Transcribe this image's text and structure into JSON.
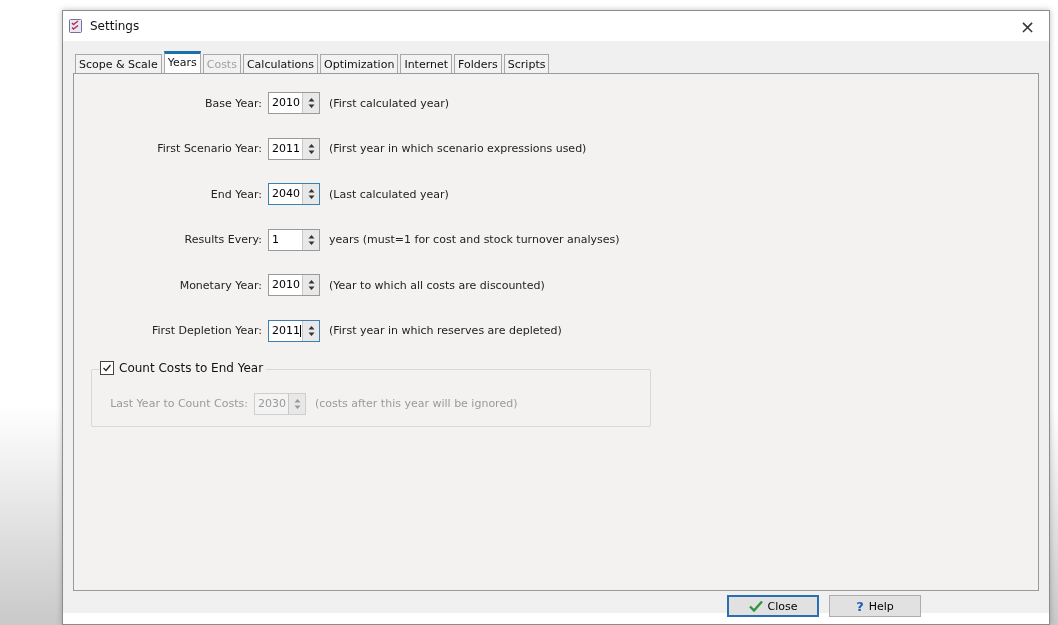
{
  "window": {
    "title": "Settings",
    "close": "×"
  },
  "tabs": [
    {
      "label": "Scope & Scale",
      "selected": false,
      "disabled": false
    },
    {
      "label": "Years",
      "selected": true,
      "disabled": false
    },
    {
      "label": "Costs",
      "selected": false,
      "disabled": true
    },
    {
      "label": "Calculations",
      "selected": false,
      "disabled": false
    },
    {
      "label": "Optimization",
      "selected": false,
      "disabled": false
    },
    {
      "label": "Internet",
      "selected": false,
      "disabled": false
    },
    {
      "label": "Folders",
      "selected": false,
      "disabled": false
    },
    {
      "label": "Scripts",
      "selected": false,
      "disabled": false
    }
  ],
  "fields": [
    {
      "label": "Base Year:",
      "value": "2010",
      "hint": "(First calculated year)",
      "focused": false
    },
    {
      "label": "First Scenario Year:",
      "value": "2011",
      "hint": "(First year in which scenario expressions used)",
      "focused": false
    },
    {
      "label": "End Year:",
      "value": "2040",
      "hint": "(Last calculated year)",
      "focused": true
    },
    {
      "label": "Results Every:",
      "value": "1",
      "hint": "years (must=1 for cost and stock turnover analyses)",
      "focused": false
    },
    {
      "label": "Monetary Year:",
      "value": "2010",
      "hint": "(Year to which all costs are  discounted)",
      "focused": false
    },
    {
      "label": "First Depletion Year:",
      "value": "2011",
      "hint": "(First year in which reserves are depleted)",
      "focused": true
    }
  ],
  "count_costs": {
    "label": "Count Costs to End Year",
    "checked": true,
    "field": {
      "label": "Last Year to Count Costs:",
      "value": "2030",
      "hint": "(costs after this year will be ignored)",
      "disabled": true
    }
  },
  "buttons": [
    {
      "label": "Close",
      "kind": "default"
    },
    {
      "label": "Help",
      "kind": "help",
      "icon": "?"
    }
  ]
}
